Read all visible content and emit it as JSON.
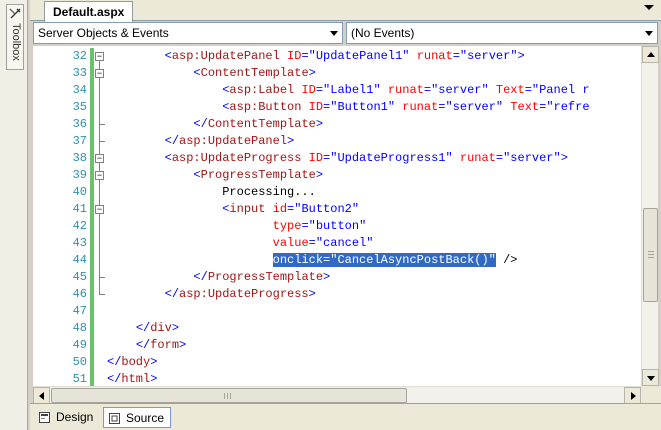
{
  "toolbox": {
    "label": "Toolbox",
    "icon": "toolbox-icon"
  },
  "tabbar": {
    "doc_tab": "Default.aspx",
    "close_glyph": "✕"
  },
  "combos": {
    "objects": "Server Objects & Events",
    "events": "(No Events)"
  },
  "editor": {
    "lines": [
      {
        "num": "32",
        "text": "        <asp:UpdatePanel ID=\"UpdatePanel1\" runat=\"server\">"
      },
      {
        "num": "33",
        "text": "            <ContentTemplate>"
      },
      {
        "num": "34",
        "text": "                <asp:Label ID=\"Label1\" runat=\"server\" Text=\"Panel r"
      },
      {
        "num": "35",
        "text": "                <asp:Button ID=\"Button1\" runat=\"server\" Text=\"refre"
      },
      {
        "num": "36",
        "text": "            </ContentTemplate>"
      },
      {
        "num": "37",
        "text": "        </asp:UpdatePanel>"
      },
      {
        "num": "38",
        "text": "        <asp:UpdateProgress ID=\"UpdateProgress1\" runat=\"server\">"
      },
      {
        "num": "39",
        "text": "            <ProgressTemplate>"
      },
      {
        "num": "40",
        "text": "                Processing..."
      },
      {
        "num": "41",
        "text": "                <input id=\"Button2\""
      },
      {
        "num": "42",
        "text": "                       type=\"button\""
      },
      {
        "num": "43",
        "text": "                       value=\"cancel\""
      },
      {
        "num": "44",
        "text": "                       onclick=\"CancelAsyncPostBack()\" />"
      },
      {
        "num": "45",
        "text": "            </ProgressTemplate>"
      },
      {
        "num": "46",
        "text": "        </asp:UpdateProgress>"
      },
      {
        "num": "47",
        "text": ""
      },
      {
        "num": "48",
        "text": "    </div>"
      },
      {
        "num": "49",
        "text": "    </form>"
      },
      {
        "num": "50",
        "text": "</body>"
      },
      {
        "num": "51",
        "text": "</html>"
      }
    ]
  },
  "view_tabs": {
    "design": "Design",
    "source": "Source",
    "active": "Source"
  },
  "colors": {
    "line_number": "#2b91af",
    "tag": "#a31515",
    "attribute": "#ff0000",
    "punctuation": "#0000ff",
    "selection": "#316ac5",
    "change_bar": "#6ac36a"
  }
}
